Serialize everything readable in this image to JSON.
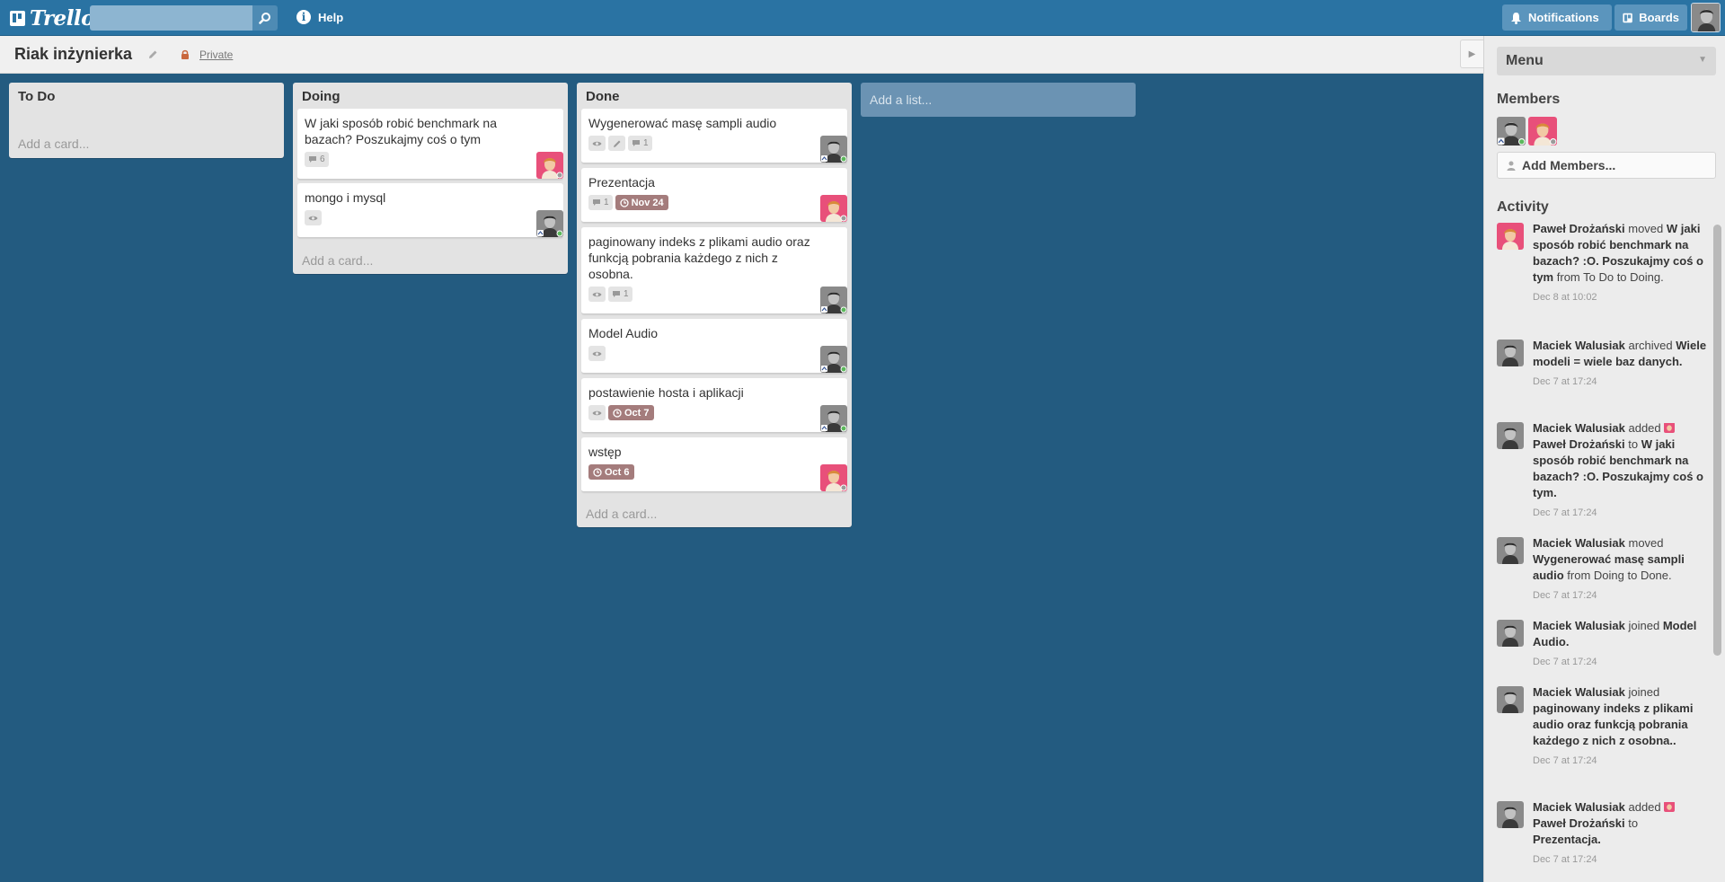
{
  "app": {
    "logo": "Trello",
    "help_label": "Help",
    "notifications_label": "Notifications",
    "boards_label": "Boards"
  },
  "search": {
    "value": "",
    "placeholder": ""
  },
  "board": {
    "title": "Riak inżynierka",
    "visibility": "Private",
    "add_list": "Add a list..."
  },
  "lists": [
    {
      "title": "To Do",
      "add_card": "Add a card...",
      "cards": []
    },
    {
      "title": "Doing",
      "add_card": "Add a card...",
      "cards": [
        {
          "text": "W jaki sposób robić benchmark na bazach? Poszukajmy coś o tym",
          "comments": "6",
          "member": "pawel"
        },
        {
          "text": "mongo i mysql",
          "watch": true,
          "member": "maciek"
        }
      ]
    },
    {
      "title": "Done",
      "add_card": "Add a card...",
      "cards": [
        {
          "text": "Wygenerować masę sampli audio",
          "watch": true,
          "description": true,
          "comments": "1",
          "member": "maciek"
        },
        {
          "text": "Prezentacja",
          "comments": "1",
          "due": "Nov 24",
          "member": "pawel"
        },
        {
          "text": "paginowany indeks z plikami audio oraz funkcją pobrania każdego z nich z osobna.",
          "watch": true,
          "comments": "1",
          "member": "maciek"
        },
        {
          "text": "Model Audio",
          "watch": true,
          "member": "maciek"
        },
        {
          "text": "postawienie hosta i aplikacji",
          "watch": true,
          "due": "Oct 7",
          "member": "maciek"
        },
        {
          "text": "wstęp",
          "due": "Oct 6",
          "member": "pawel"
        }
      ]
    }
  ],
  "sidebar": {
    "menu_label": "Menu",
    "members_title": "Members",
    "add_members": "Add Members...",
    "activity_title": "Activity",
    "activity": [
      {
        "avatar": "pawel",
        "who": "Paweł Drożański",
        "verb": "moved",
        "target": "W jaki sposób robić benchmark na bazach? :O. Poszukajmy coś o tym",
        "rest": "from To Do to Doing.",
        "date": "Dec 8 at 10:02"
      },
      {
        "avatar": "maciek",
        "who": "Maciek Walusiak",
        "verb": "archived",
        "target": "Wiele modeli = wiele baz danych.",
        "rest": "",
        "date": "Dec 7 at 17:24"
      },
      {
        "avatar": "maciek",
        "who": "Maciek Walusiak",
        "verb": "added",
        "object": "Paweł Drożański",
        "prep": "to",
        "target": "W jaki sposób robić benchmark na bazach? :O. Poszukajmy coś o tym.",
        "rest": "",
        "date": "Dec 7 at 17:24"
      },
      {
        "avatar": "maciek",
        "who": "Maciek Walusiak",
        "verb": "moved",
        "target": "Wygenerować masę sampli audio",
        "rest": "from Doing to Done.",
        "date": "Dec 7 at 17:24"
      },
      {
        "avatar": "maciek",
        "who": "Maciek Walusiak",
        "verb": "joined",
        "target": "Model Audio.",
        "rest": "",
        "date": "Dec 7 at 17:24"
      },
      {
        "avatar": "maciek",
        "who": "Maciek Walusiak",
        "verb": "joined",
        "target": "paginowany indeks z plikami audio oraz funkcją pobrania każdego z nich z osobna..",
        "rest": "",
        "date": "Dec 7 at 17:24"
      },
      {
        "avatar": "maciek",
        "who": "Maciek Walusiak",
        "verb": "added",
        "object": "Paweł Drożański",
        "prep": "to",
        "target": "Prezentacja.",
        "rest": "",
        "date": "Dec 7 at 17:24"
      }
    ]
  },
  "colors": {
    "board_bg": "#235b80",
    "header_bg": "#2a73a3",
    "due_badge": "#a47c7c",
    "list_bg": "#e3e3e3"
  },
  "icons": [
    "trello-logo-icon",
    "search-icon",
    "help-icon",
    "bell-icon",
    "boards-icon",
    "pencil-icon",
    "lock-icon",
    "eye-icon",
    "comment-icon",
    "description-icon",
    "clock-icon",
    "person-icon",
    "chevron-down-icon",
    "collapse-arrow-icon"
  ]
}
